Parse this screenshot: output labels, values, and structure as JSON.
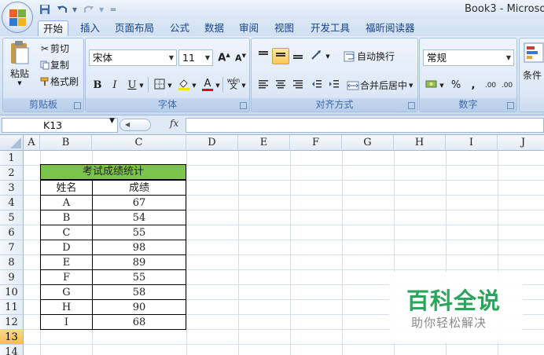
{
  "window": {
    "title": "Book3 - Microso"
  },
  "quick_access": {
    "items": [
      "save-icon",
      "undo-icon",
      "redo-icon",
      "customize-icon"
    ]
  },
  "tabs": [
    {
      "label": "开始",
      "active": true
    },
    {
      "label": "插入"
    },
    {
      "label": "页面布局"
    },
    {
      "label": "公式"
    },
    {
      "label": "数据"
    },
    {
      "label": "审阅"
    },
    {
      "label": "视图"
    },
    {
      "label": "开发工具"
    },
    {
      "label": "福昕阅读器"
    }
  ],
  "ribbon": {
    "clipboard": {
      "label": "剪贴板",
      "paste": "粘贴",
      "cut": "剪切",
      "copy": "复制",
      "format_painter": "格式刷"
    },
    "font": {
      "label": "字体",
      "font_name": "宋体",
      "font_size": "11",
      "bold": "B",
      "italic": "I",
      "underline": "U",
      "phonetic": "wén"
    },
    "alignment": {
      "label": "对齐方式",
      "wrap_text": "自动换行",
      "merge_center": "合并后居中"
    },
    "number": {
      "label": "数字",
      "format": "常规",
      "percent": "%",
      "comma": ",",
      "inc_decimal": ".00",
      "dec_decimal": ".00"
    },
    "styles": {
      "conditional": "条件"
    }
  },
  "formula_bar": {
    "name_box": "K13",
    "fx": "fx",
    "formula": ""
  },
  "columns": [
    "A",
    "B",
    "C",
    "D",
    "E",
    "F",
    "G",
    "H",
    "I",
    "J"
  ],
  "rows": [
    "1",
    "2",
    "3",
    "4",
    "5",
    "6",
    "7",
    "8",
    "9",
    "10",
    "11",
    "12",
    "13",
    "14"
  ],
  "selected_row": "13",
  "table": {
    "title": "考试成绩统计",
    "title_color": "#7cc34a",
    "headers": [
      "姓名",
      "成绩"
    ],
    "rows": [
      [
        "A",
        "67"
      ],
      [
        "B",
        "54"
      ],
      [
        "C",
        "55"
      ],
      [
        "D",
        "98"
      ],
      [
        "E",
        "89"
      ],
      [
        "F",
        "55"
      ],
      [
        "G",
        "58"
      ],
      [
        "H",
        "90"
      ],
      [
        "I",
        "68"
      ]
    ]
  },
  "watermark": {
    "title": "百科全说",
    "subtitle": "助你轻松解决",
    "color": "#2aa55c"
  }
}
